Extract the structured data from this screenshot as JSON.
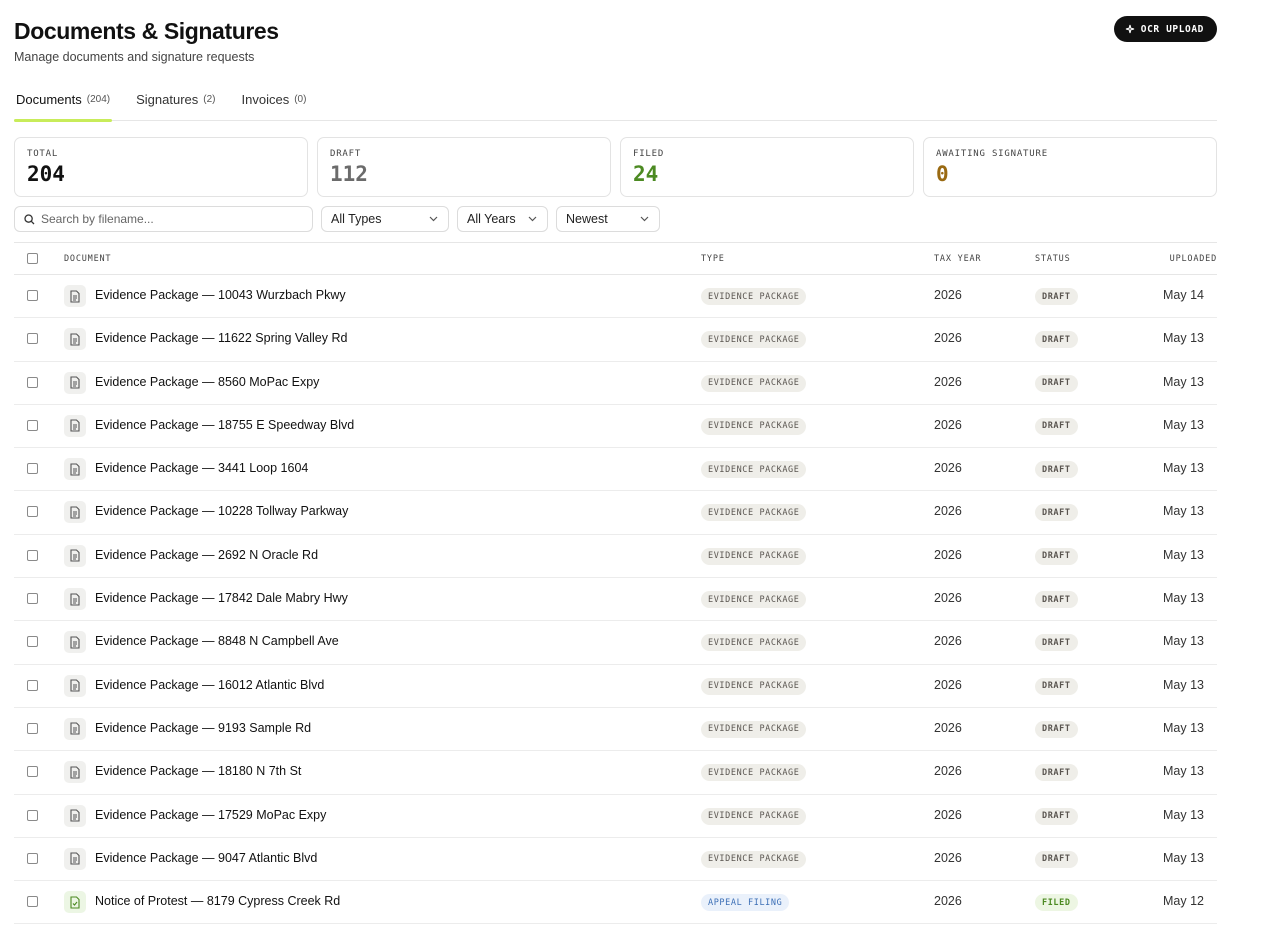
{
  "header": {
    "title": "Documents & Signatures",
    "subtitle": "Manage documents and signature requests",
    "ocr_button": "OCR UPLOAD"
  },
  "tabs": [
    {
      "label": "Documents",
      "count": "(204)",
      "active": true
    },
    {
      "label": "Signatures",
      "count": "(2)",
      "active": false
    },
    {
      "label": "Invoices",
      "count": "(0)",
      "active": false
    }
  ],
  "stats": [
    {
      "label": "TOTAL",
      "value": "204",
      "color": "#111111"
    },
    {
      "label": "DRAFT",
      "value": "112",
      "color": "#6b6b6b"
    },
    {
      "label": "FILED",
      "value": "24",
      "color": "#4c8a22"
    },
    {
      "label": "AWAITING SIGNATURE",
      "value": "0",
      "color": "#9a6a12"
    }
  ],
  "filters": {
    "search_placeholder": "Search by filename...",
    "type_select": "All Types",
    "year_select": "All Years",
    "sort_select": "Newest"
  },
  "table": {
    "columns": [
      "DOCUMENT",
      "TYPE",
      "TAX YEAR",
      "STATUS",
      "UPLOADED"
    ],
    "rows": [
      {
        "name": "Evidence Package — 10043 Wurzbach Pkwy",
        "type": "EVIDENCE PACKAGE",
        "tax_year": "2026",
        "status": "DRAFT",
        "uploaded": "May 14"
      },
      {
        "name": "Evidence Package — 11622 Spring Valley Rd",
        "type": "EVIDENCE PACKAGE",
        "tax_year": "2026",
        "status": "DRAFT",
        "uploaded": "May 13"
      },
      {
        "name": "Evidence Package — 8560 MoPac Expy",
        "type": "EVIDENCE PACKAGE",
        "tax_year": "2026",
        "status": "DRAFT",
        "uploaded": "May 13"
      },
      {
        "name": "Evidence Package — 18755 E Speedway Blvd",
        "type": "EVIDENCE PACKAGE",
        "tax_year": "2026",
        "status": "DRAFT",
        "uploaded": "May 13"
      },
      {
        "name": "Evidence Package — 3441 Loop 1604",
        "type": "EVIDENCE PACKAGE",
        "tax_year": "2026",
        "status": "DRAFT",
        "uploaded": "May 13"
      },
      {
        "name": "Evidence Package — 10228 Tollway Parkway",
        "type": "EVIDENCE PACKAGE",
        "tax_year": "2026",
        "status": "DRAFT",
        "uploaded": "May 13"
      },
      {
        "name": "Evidence Package — 2692 N Oracle Rd",
        "type": "EVIDENCE PACKAGE",
        "tax_year": "2026",
        "status": "DRAFT",
        "uploaded": "May 13"
      },
      {
        "name": "Evidence Package — 17842 Dale Mabry Hwy",
        "type": "EVIDENCE PACKAGE",
        "tax_year": "2026",
        "status": "DRAFT",
        "uploaded": "May 13"
      },
      {
        "name": "Evidence Package — 8848 N Campbell Ave",
        "type": "EVIDENCE PACKAGE",
        "tax_year": "2026",
        "status": "DRAFT",
        "uploaded": "May 13"
      },
      {
        "name": "Evidence Package — 16012 Atlantic Blvd",
        "type": "EVIDENCE PACKAGE",
        "tax_year": "2026",
        "status": "DRAFT",
        "uploaded": "May 13"
      },
      {
        "name": "Evidence Package — 9193 Sample Rd",
        "type": "EVIDENCE PACKAGE",
        "tax_year": "2026",
        "status": "DRAFT",
        "uploaded": "May 13"
      },
      {
        "name": "Evidence Package — 18180 N 7th St",
        "type": "EVIDENCE PACKAGE",
        "tax_year": "2026",
        "status": "DRAFT",
        "uploaded": "May 13"
      },
      {
        "name": "Evidence Package — 17529 MoPac Expy",
        "type": "EVIDENCE PACKAGE",
        "tax_year": "2026",
        "status": "DRAFT",
        "uploaded": "May 13"
      },
      {
        "name": "Evidence Package — 9047 Atlantic Blvd",
        "type": "EVIDENCE PACKAGE",
        "tax_year": "2026",
        "status": "DRAFT",
        "uploaded": "May 13"
      },
      {
        "name": "Notice of Protest — 8179 Cypress Creek Rd",
        "type": "APPEAL FILING",
        "tax_year": "2026",
        "status": "FILED",
        "uploaded": "May 12"
      }
    ]
  }
}
